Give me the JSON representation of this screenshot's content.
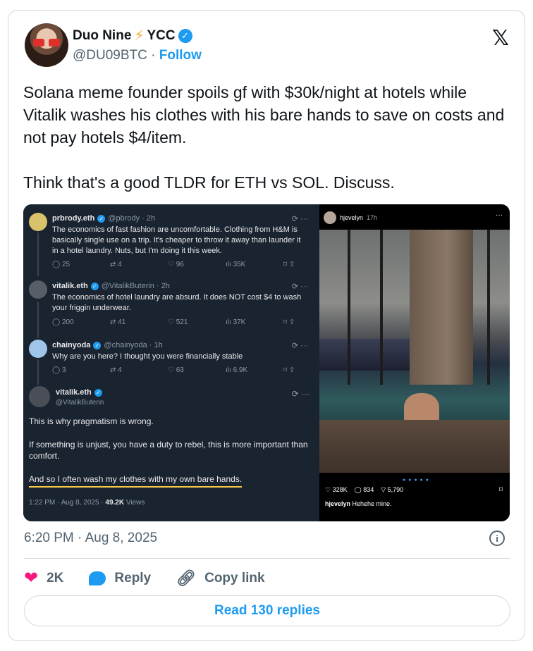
{
  "author": {
    "display_name": "Duo Nine",
    "emoji": "⚡",
    "display_suffix": "YCC",
    "handle": "@DU09BTC",
    "separator": "·",
    "follow_label": "Follow"
  },
  "tweet": {
    "paragraph1": "Solana meme founder spoils gf with $30k/night at hotels while Vitalik washes his clothes with his bare hands to save on costs and not pay hotels $4/item.",
    "paragraph2": "Think that's a good TLDR for ETH vs SOL. Discuss."
  },
  "embedded": {
    "replies": [
      {
        "name": "prbrody.eth",
        "handle": "@pbrody · 2h",
        "text": "The economics of fast fashion are uncomfortable.  Clothing from H&M is basically single use on a trip.  It's cheaper to throw it away than launder it in a hotel laundry.  Nuts, but I'm doing it this week.",
        "comments": "25",
        "reposts": "4",
        "likes": "96",
        "views": "35K"
      },
      {
        "name": "vitalik.eth",
        "handle": "@VitalikButerin · 2h",
        "text": "The economics of hotel laundry are absurd. It does NOT cost $4 to wash your friggin underwear.",
        "comments": "200",
        "reposts": "41",
        "likes": "521",
        "views": "37K"
      },
      {
        "name": "chainyoda",
        "handle": "@chainyoda · 1h",
        "text": "Why are you here? I thought you were financially stable",
        "comments": "3",
        "reposts": "4",
        "likes": "63",
        "views": "6.9K"
      }
    ],
    "main": {
      "name": "vitalik.eth",
      "handle": "@VitalikButerin",
      "line1": "This is why pragmatism is wrong.",
      "line2": "If something is unjust, you have a duty to rebel, this is more important than comfort.",
      "line3": "And so I often wash my clothes with my own bare hands.",
      "time": "1:22 PM · Aug 8, 2025 · ",
      "views_count": "49.2K",
      "views_label": " Views"
    },
    "instagram": {
      "user": "hjevelyn",
      "time": "17h",
      "likes": "328K",
      "comments": "834",
      "shares": "5,790",
      "caption_user": "hjevelyn",
      "caption": " Hehehe mine."
    }
  },
  "timestamp": "6:20 PM · Aug 8, 2025",
  "actions": {
    "like_count": "2K",
    "reply_label": "Reply",
    "copy_label": "Copy link"
  },
  "read_replies_label": "Read 130 replies"
}
